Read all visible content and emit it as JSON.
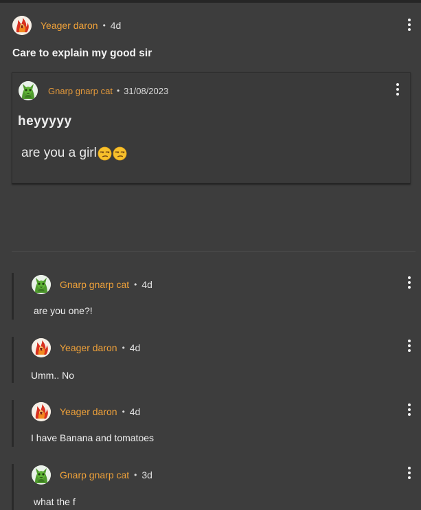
{
  "post": {
    "author": "Yeager daron",
    "separator": "•",
    "time": "4d",
    "title": "Care to explain my good sir"
  },
  "quote": {
    "author": "Gnarp gnarp cat",
    "separator": "•",
    "time": "31/08/2023",
    "title": "heyyyyy",
    "body": "are you a girl"
  },
  "comments": [
    {
      "author": "Gnarp gnarp cat",
      "separator": "•",
      "time": "4d",
      "body": "are you one?!"
    },
    {
      "author": "Yeager daron",
      "separator": "•",
      "time": "4d",
      "body": "Umm.. No"
    },
    {
      "author": "Yeager daron",
      "separator": "•",
      "time": "4d",
      "body": "I have Banana and tomatoes"
    },
    {
      "author": "Gnarp gnarp cat",
      "separator": "•",
      "time": "3d",
      "body": "what the f"
    }
  ],
  "colors": {
    "background": "#3d3d3d",
    "author": "#f0a23a",
    "thread_bar": "#2a2a2a"
  },
  "icons": {
    "menu": "more-vertical-icon",
    "emoji": "unamused-face-emoji"
  }
}
